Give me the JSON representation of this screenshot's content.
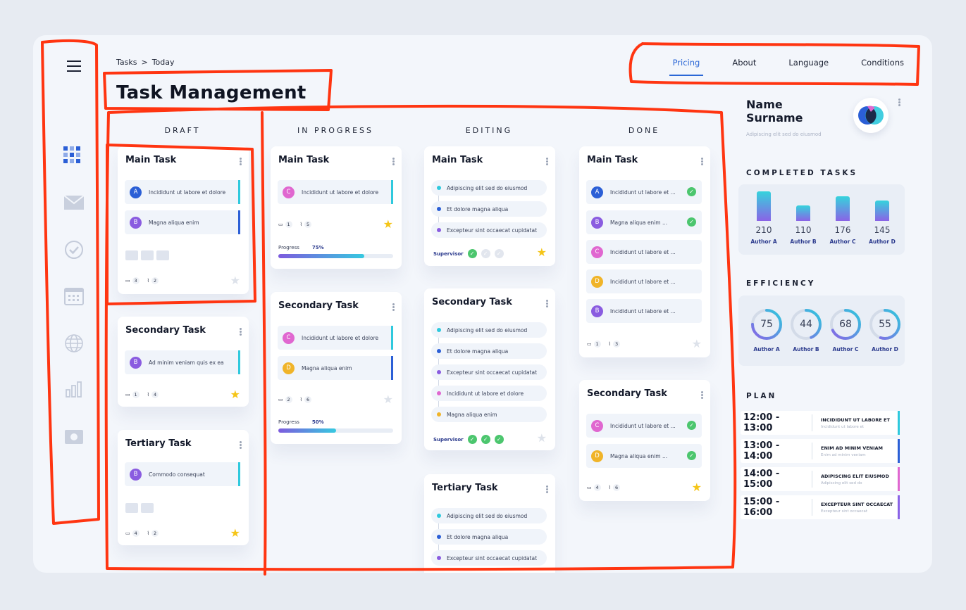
{
  "breadcrumb": {
    "root": "Tasks",
    "separator": ">",
    "current": "Today"
  },
  "page_title": "Task Management",
  "top_nav": {
    "items": [
      "Pricing",
      "About",
      "Language",
      "Conditions"
    ],
    "active": "Pricing"
  },
  "sidebar": {
    "icons": [
      "menu-icon",
      "dashboard-icon",
      "mail-icon",
      "check-circle-icon",
      "calendar-icon",
      "globe-icon",
      "chart-icon",
      "camera-icon"
    ]
  },
  "columns": [
    "DRAFT",
    "IN PROGRESS",
    "EDITING",
    "DONE"
  ],
  "draft": {
    "main": {
      "title": "Main Task",
      "rows": [
        {
          "avatar": "A",
          "text": "Incididunt ut labore et dolore"
        },
        {
          "avatar": "B",
          "text": "Magna aliqua enim"
        }
      ],
      "comments": "3",
      "attachments": "2",
      "starred": false
    },
    "secondary": {
      "title": "Secondary Task",
      "rows": [
        {
          "avatar": "B",
          "text": "Ad minim veniam  quis ex ea"
        }
      ],
      "comments": "1",
      "attachments": "4",
      "starred": true
    },
    "tertiary": {
      "title": "Tertiary Task",
      "rows": [
        {
          "avatar": "B",
          "text": "Commodo consequat"
        }
      ],
      "comments": "4",
      "attachments": "2",
      "starred": true
    }
  },
  "progress": {
    "main": {
      "title": "Main Task",
      "rows": [
        {
          "avatar": "C",
          "text": "Incididunt ut labore et dolore"
        }
      ],
      "comments": "1",
      "attachments": "5",
      "progress_label": "Progress",
      "progress_text": "75%",
      "progress": 0.75,
      "starred": true
    },
    "secondary": {
      "title": "Secondary Task",
      "rows": [
        {
          "avatar": "C",
          "text": "Incididunt ut labore et dolore"
        },
        {
          "avatar": "D",
          "text": "Magna aliqua enim"
        }
      ],
      "comments": "2",
      "attachments": "6",
      "progress_label": "Progress",
      "progress_text": "50%",
      "progress": 0.5,
      "starred": false
    }
  },
  "editing": {
    "main": {
      "title": "Main Task",
      "items": [
        "Adipiscing elit sed do eiusmod",
        "Et dolore magna aliqua",
        "Excepteur sint occaecat cupidatat"
      ],
      "supervisor": "Supervisor",
      "checks_done": 1,
      "starred": true
    },
    "secondary": {
      "title": "Secondary Task",
      "items": [
        "Adipiscing elit sed do eiusmod",
        "Et dolore magna aliqua",
        "Excepteur sint occaecat cupidatat",
        "Incididunt ut labore et dolore",
        "Magna aliqua enim"
      ],
      "supervisor": "Supervisor",
      "checks_done": 3,
      "starred": false
    },
    "tertiary": {
      "title": "Tertiary Task",
      "items": [
        "Adipiscing elit sed do eiusmod",
        "Et dolore magna aliqua",
        "Excepteur sint occaecat cupidatat"
      ]
    }
  },
  "done": {
    "main": {
      "title": "Main Task",
      "rows": [
        {
          "avatar": "A",
          "text": "Incididunt ut labore et ...",
          "checked": true
        },
        {
          "avatar": "B",
          "text": "Magna aliqua enim ...",
          "checked": true
        },
        {
          "avatar": "C",
          "text": "Incididunt ut labore et ...",
          "checked": false
        },
        {
          "avatar": "D",
          "text": "Incididunt ut labore et ...",
          "checked": false
        },
        {
          "avatar": "B",
          "text": "Incididunt ut labore et ...",
          "checked": false
        }
      ],
      "comments": "1",
      "attachments": "3",
      "starred": false
    },
    "secondary": {
      "title": "Secondary Task",
      "rows": [
        {
          "avatar": "C",
          "text": "Incididunt ut labore et ...",
          "checked": true
        },
        {
          "avatar": "D",
          "text": "Magna aliqua enim ...",
          "checked": true
        }
      ],
      "comments": "4",
      "attachments": "6",
      "starred": true
    }
  },
  "profile": {
    "name_line1": "Name",
    "name_line2": "Surname",
    "subtitle": "Adipiscing elit sed do eiusmod"
  },
  "completed_tasks": {
    "heading": "COMPLETED TASKS"
  },
  "efficiency": {
    "heading": "EFFICIENCY"
  },
  "plan": {
    "heading": "PLAN",
    "items": [
      {
        "time": "12:00 - 13:00",
        "title": "INCIDIDUNT UT LABORE ET",
        "sub": "Incididunt ut labore et",
        "color": "#2fc9dd"
      },
      {
        "time": "13:00 - 14:00",
        "title": "ENIM AD MINIM VENIAM",
        "sub": "Enim ad minim veniam",
        "color": "#2b5fd6"
      },
      {
        "time": "14:00 - 15:00",
        "title": "ADIPISCING ELIT EIUSMOD",
        "sub": "Adipiscing elit sed do",
        "color": "#e067d0"
      },
      {
        "time": "15:00 - 16:00",
        "title": "EXCEPTEUR SINT OCCAECAT",
        "sub": "Excepteur sint occaecat",
        "color": "#8a63e6"
      }
    ]
  },
  "avatar_colors": {
    "A": "#2b5fd6",
    "B": "#8a5ce0",
    "C": "#e067d0",
    "D": "#f0b429"
  },
  "chart_data": [
    {
      "type": "bar",
      "title": "COMPLETED TASKS",
      "categories": [
        "Author A",
        "Author B",
        "Author C",
        "Author D"
      ],
      "values": [
        210,
        110,
        176,
        145
      ]
    },
    {
      "type": "pie",
      "title": "EFFICIENCY",
      "categories": [
        "Author A",
        "Author B",
        "Author C",
        "Author D"
      ],
      "values": [
        75,
        44,
        68,
        55
      ],
      "max": 100
    }
  ]
}
